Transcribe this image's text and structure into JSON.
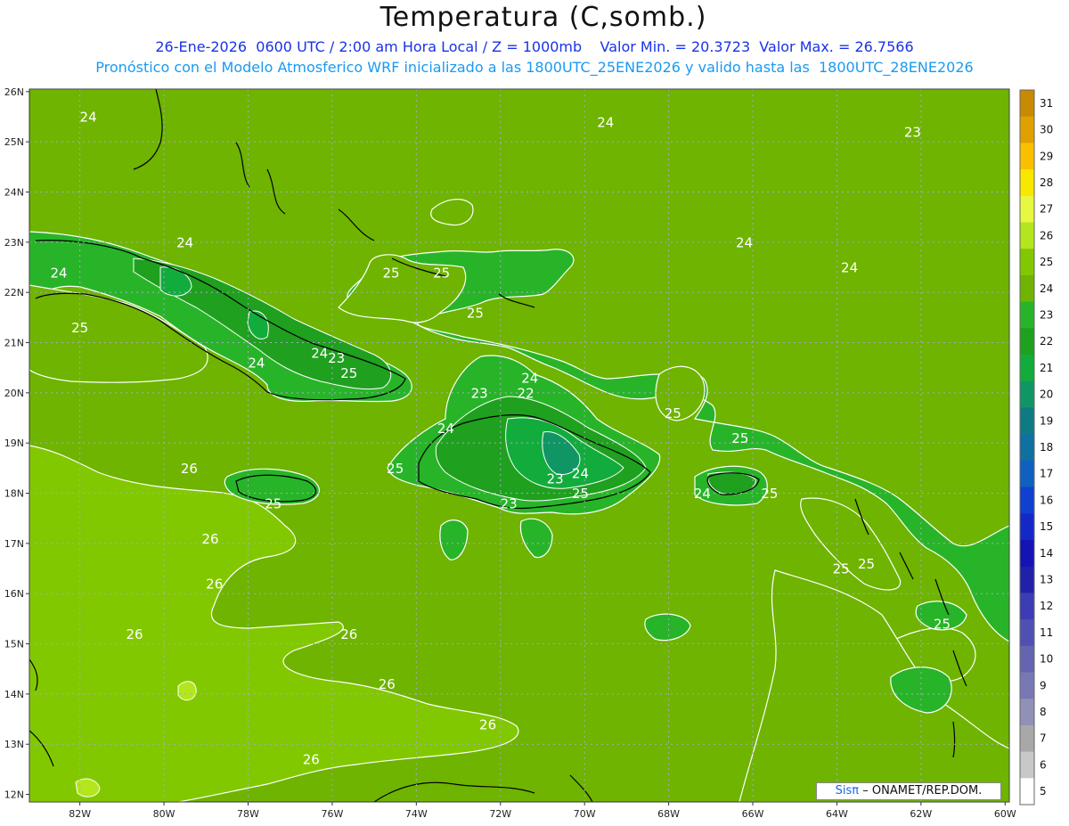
{
  "header": {
    "title": "Temperatura (C,somb.)",
    "subtitle": "26-Ene-2026  0600 UTC / 2:00 am Hora Local / Z = 1000mb    Valor Min. = 20.3723  Valor Max. = 26.7566",
    "subtitle2": "Pronóstico con el Modelo Atmosferico WRF inicializado a las 1800UTC_25ENE2026 y valido hasta las  1800UTC_28ENE2026"
  },
  "map": {
    "lat_labels": [
      "26N",
      "25N",
      "24N",
      "23N",
      "22N",
      "21N",
      "20N",
      "19N",
      "18N",
      "17N",
      "16N",
      "15N",
      "14N",
      "13N",
      "12N"
    ],
    "lon_labels": [
      "82W",
      "80W",
      "78W",
      "76W",
      "74W",
      "72W",
      "70W",
      "68W",
      "66W",
      "64W",
      "62W",
      "60W"
    ],
    "contour_labels": [
      {
        "text": "24",
        "lon": -81.8,
        "lat": 25.4
      },
      {
        "text": "24",
        "lon": -82.5,
        "lat": 22.3
      },
      {
        "text": "24",
        "lon": -79.5,
        "lat": 22.9
      },
      {
        "text": "25",
        "lon": -82.0,
        "lat": 21.2
      },
      {
        "text": "24",
        "lon": -77.8,
        "lat": 20.5
      },
      {
        "text": "24",
        "lon": -76.3,
        "lat": 20.7
      },
      {
        "text": "23",
        "lon": -75.9,
        "lat": 20.6
      },
      {
        "text": "25",
        "lon": -75.6,
        "lat": 20.3
      },
      {
        "text": "25",
        "lon": -74.6,
        "lat": 22.3
      },
      {
        "text": "25",
        "lon": -73.4,
        "lat": 22.3
      },
      {
        "text": "25",
        "lon": -72.6,
        "lat": 21.5
      },
      {
        "text": "24",
        "lon": -71.3,
        "lat": 20.2
      },
      {
        "text": "23",
        "lon": -72.5,
        "lat": 19.9
      },
      {
        "text": "22",
        "lon": -71.4,
        "lat": 19.9
      },
      {
        "text": "24",
        "lon": -73.3,
        "lat": 19.2
      },
      {
        "text": "25",
        "lon": -74.5,
        "lat": 18.4
      },
      {
        "text": "23",
        "lon": -70.7,
        "lat": 18.2
      },
      {
        "text": "24",
        "lon": -70.1,
        "lat": 18.3
      },
      {
        "text": "25",
        "lon": -70.1,
        "lat": 17.9
      },
      {
        "text": "23",
        "lon": -71.8,
        "lat": 17.7
      },
      {
        "text": "26",
        "lon": -79.4,
        "lat": 18.4
      },
      {
        "text": "25",
        "lon": -77.4,
        "lat": 17.7
      },
      {
        "text": "26",
        "lon": -78.9,
        "lat": 17.0
      },
      {
        "text": "26",
        "lon": -78.8,
        "lat": 16.1
      },
      {
        "text": "26",
        "lon": -80.7,
        "lat": 15.1
      },
      {
        "text": "26",
        "lon": -75.6,
        "lat": 15.1
      },
      {
        "text": "26",
        "lon": -74.7,
        "lat": 14.1
      },
      {
        "text": "26",
        "lon": -72.3,
        "lat": 13.3
      },
      {
        "text": "26",
        "lon": -76.5,
        "lat": 12.6
      },
      {
        "text": "24",
        "lon": -67.2,
        "lat": 17.9
      },
      {
        "text": "25",
        "lon": -65.6,
        "lat": 17.9
      },
      {
        "text": "25",
        "lon": -67.9,
        "lat": 19.5
      },
      {
        "text": "25",
        "lon": -66.3,
        "lat": 19.0
      },
      {
        "text": "24",
        "lon": -69.5,
        "lat": 25.3
      },
      {
        "text": "24",
        "lon": -66.2,
        "lat": 22.9
      },
      {
        "text": "24",
        "lon": -63.7,
        "lat": 22.4
      },
      {
        "text": "23",
        "lon": -62.2,
        "lat": 25.1
      },
      {
        "text": "25",
        "lon": -63.3,
        "lat": 16.5
      },
      {
        "text": "25",
        "lon": -63.9,
        "lat": 16.4
      },
      {
        "text": "25",
        "lon": -61.5,
        "lat": 15.3
      }
    ]
  },
  "colorbar": {
    "labels": [
      "31",
      "30",
      "29",
      "28",
      "27",
      "26",
      "25",
      "24",
      "23",
      "22",
      "21",
      "20",
      "19",
      "18",
      "17",
      "16",
      "15",
      "14",
      "13",
      "12",
      "11",
      "10",
      "9",
      "8",
      "7",
      "6",
      "5"
    ],
    "colors": [
      "#c88a00",
      "#e0a000",
      "#fac000",
      "#f8e800",
      "#e8f840",
      "#b4e61e",
      "#82c800",
      "#6eb400",
      "#28b428",
      "#1fa01f",
      "#12ac3c",
      "#109664",
      "#107a84",
      "#1070a0",
      "#1060c0",
      "#1040d0",
      "#1428c8",
      "#1414b4",
      "#2020a8",
      "#3c3cb4",
      "#5050b4",
      "#6464b0",
      "#7878b4",
      "#9090b8",
      "#a8a8a8",
      "#c8c8c8",
      "#ffffff"
    ],
    "value_top": 31,
    "value_bottom": 5
  },
  "credit": {
    "sis": "Sisπ",
    "text": "– ONAMET/REP.DOM."
  }
}
